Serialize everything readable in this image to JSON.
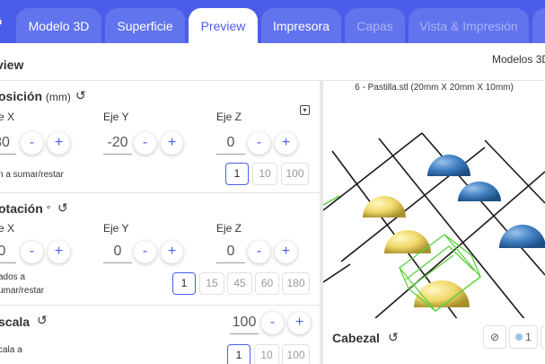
{
  "tabs": [
    {
      "label": "Modelo 3D",
      "state": "normal"
    },
    {
      "label": "Superficie",
      "state": "normal"
    },
    {
      "label": "Preview",
      "state": "active"
    },
    {
      "label": "Impresora",
      "state": "normal"
    },
    {
      "label": "Capas",
      "state": "disabled"
    },
    {
      "label": "Vista & Impresión",
      "state": "disabled"
    }
  ],
  "header": {
    "title": "view",
    "right": "Modelos 3D"
  },
  "position": {
    "title": "osición",
    "unit": "(mm)",
    "axes": [
      {
        "label": "e X",
        "value": "30"
      },
      {
        "label": "Eje Y",
        "value": "-20"
      },
      {
        "label": "Eje Z",
        "value": "0"
      }
    ],
    "step_text": "n a sumar/restar",
    "steps": [
      "1",
      "10",
      "100"
    ],
    "selected_step": "1"
  },
  "rotation": {
    "title": "otación",
    "unit": "°",
    "axes": [
      {
        "label": "e X",
        "value": "0"
      },
      {
        "label": "Eje Y",
        "value": "0"
      },
      {
        "label": "Eje Z",
        "value": "0"
      }
    ],
    "step_text": [
      "ados a",
      "umar/restar"
    ],
    "steps": [
      "1",
      "15",
      "45",
      "60",
      "180"
    ],
    "selected_step": "1"
  },
  "scale": {
    "title": "scala",
    "value": "100",
    "step_text": "cala a",
    "steps": [
      "1",
      "10",
      "100"
    ],
    "selected_step": "1"
  },
  "stepper": {
    "minus": "-",
    "plus": "+"
  },
  "preview": {
    "caption": "6 - Pastilla.stl (20mm X 20mm X 10mm)",
    "colors": {
      "yellow": "#f4e27c",
      "blue": "#3f7fc0",
      "selection": "#5ad13a",
      "grid": "#1a1a1a"
    }
  },
  "bottom": {
    "label": "Cabezal",
    "extruder_label": "1"
  },
  "colors": {
    "accent": "#4a5de8",
    "tab_bg": "#6273ee",
    "tab_disabled_text": "#a9b3f4"
  },
  "icons": {
    "reset": "reset-icon",
    "collapse": "collapse-icon",
    "disable": "disable-icon"
  }
}
